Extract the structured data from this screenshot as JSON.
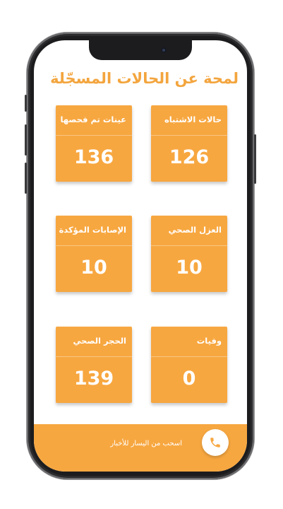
{
  "header": {
    "title": "لمحة عن الحالات المسجّلة"
  },
  "cards": [
    {
      "label": "حالات الاشتباه",
      "value": "126"
    },
    {
      "label": "عينات تم فحصها",
      "value": "136"
    },
    {
      "label": "العزل الصحي",
      "value": "10"
    },
    {
      "label": "الإصابات المؤكدة",
      "value": "10"
    },
    {
      "label": "وفيات",
      "value": "0"
    },
    {
      "label": "الحجر الصحي",
      "value": "139"
    }
  ],
  "footer": {
    "hint_text": "اسحب من اليسار للأخبار",
    "call_icon": "phone-icon"
  },
  "colors": {
    "accent": "#f7a740",
    "title": "#f3a53e",
    "frame": "#1c1c1e"
  }
}
